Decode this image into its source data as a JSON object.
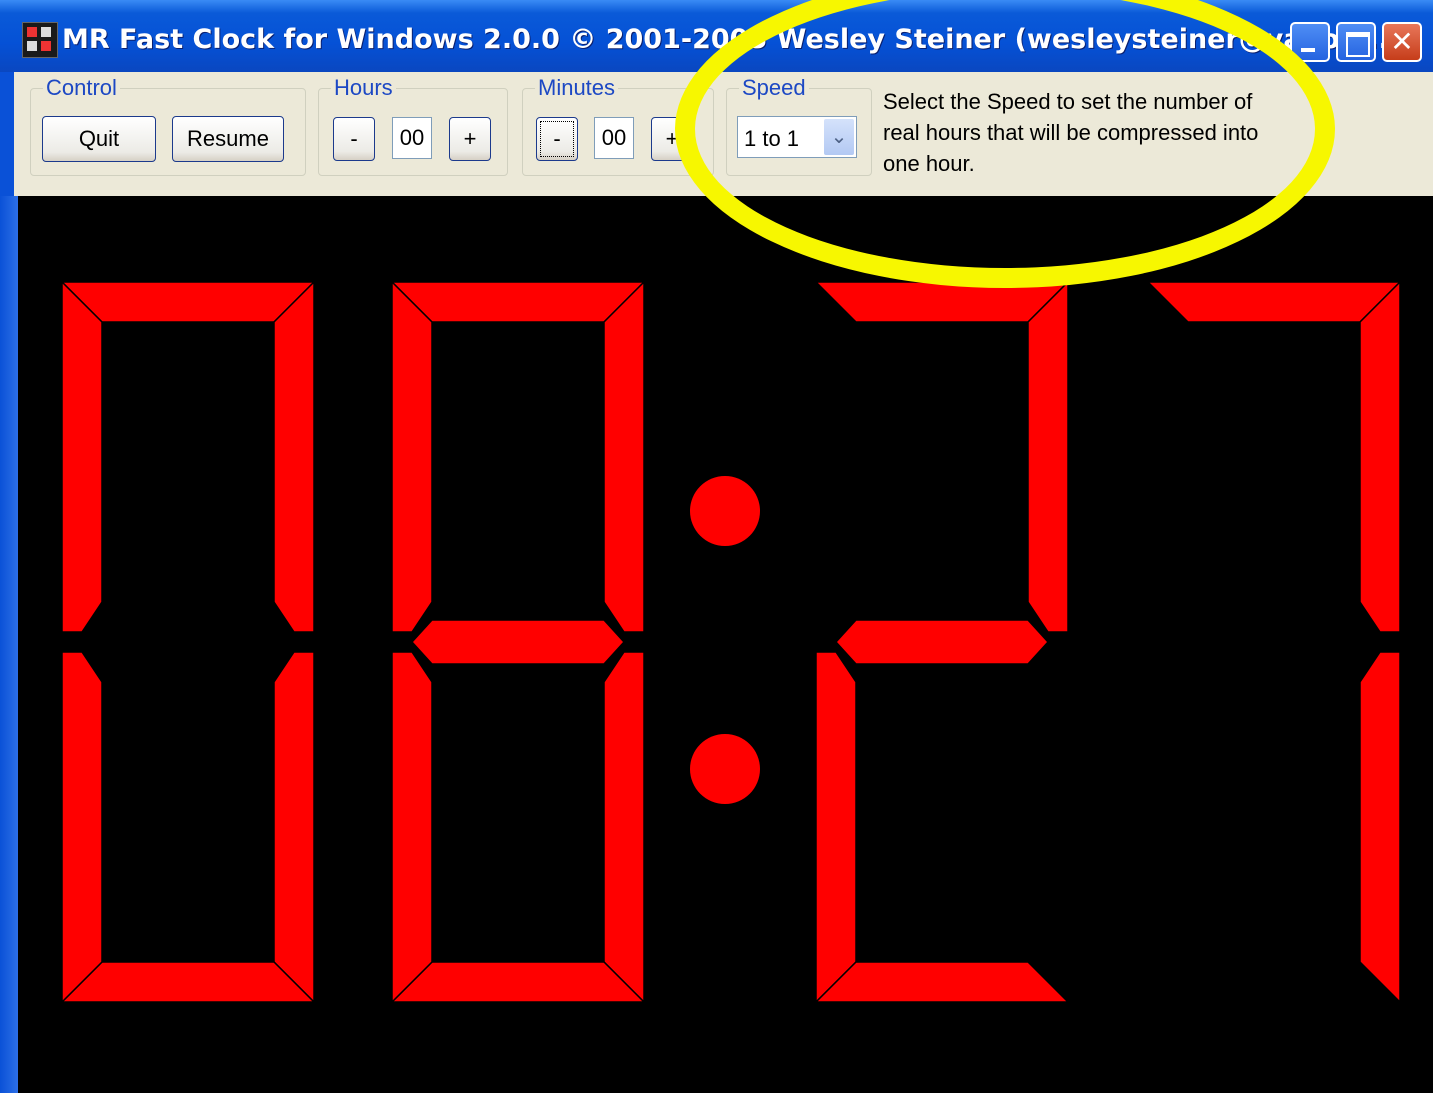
{
  "window": {
    "title": "MR Fast Clock for Windows 2.0.0 © 2001-2005 Wesley Steiner (wesleysteiner@yahoo...",
    "controls": [
      "minimize",
      "maximize",
      "close"
    ]
  },
  "control": {
    "legend": "Control",
    "quit_label": "Quit",
    "resume_label": "Resume"
  },
  "hours": {
    "legend": "Hours",
    "minus_label": "-",
    "value": "00",
    "plus_label": "+"
  },
  "minutes": {
    "legend": "Minutes",
    "minus_label": "-",
    "value": "00",
    "plus_label": "+"
  },
  "speed": {
    "legend": "Speed",
    "selected": "1 to 1",
    "hint": "Select the Speed to set the number of real hours that will be compressed into one hour."
  },
  "clock_display": {
    "digits": [
      "0",
      "8",
      "2",
      "7"
    ],
    "separator": ":",
    "segment_color": "#ff0000",
    "background": "#000000"
  },
  "annotation": {
    "highlight_color": "#f7f700"
  },
  "colors": {
    "titlebar": "#0551d6",
    "toolbar": "#ece9d8",
    "legend_text": "#1c48c4"
  }
}
